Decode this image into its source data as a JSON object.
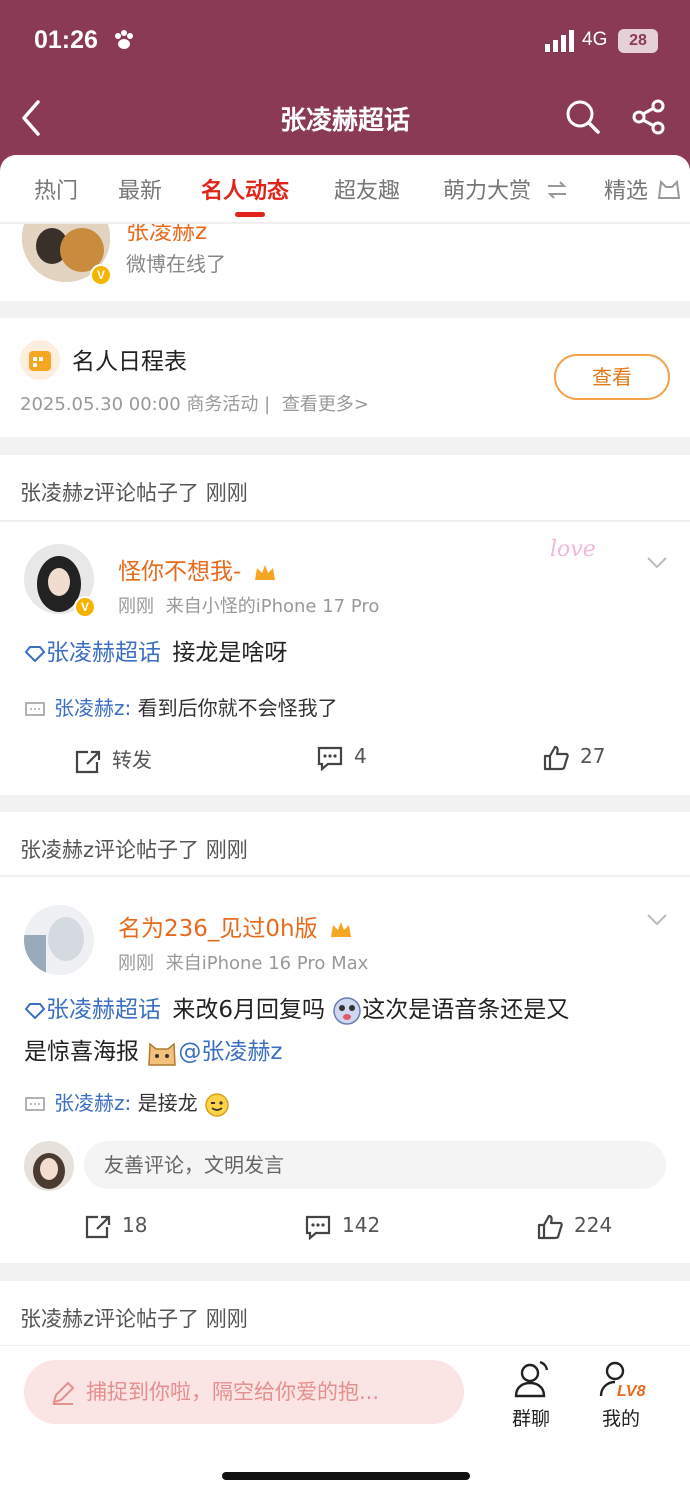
{
  "status_bar": {
    "time": "01:26",
    "network": "4G",
    "battery": "28"
  },
  "header": {
    "title": "张凌赫超话"
  },
  "tabs": [
    {
      "label": "热门"
    },
    {
      "label": "最新"
    },
    {
      "label": "名人动态",
      "active": true
    },
    {
      "label": "超友趣"
    },
    {
      "label": "萌力大赏"
    },
    {
      "label": "精选"
    }
  ],
  "top_user": {
    "name": "张凌赫z",
    "status": "微博在线了"
  },
  "schedule": {
    "title": "名人日程表",
    "info": "2025.05.30 00:00 商务活动 |",
    "more": "查看更多>",
    "button": "查看"
  },
  "posts": [
    {
      "section_title": "张凌赫z评论帖子了 刚刚",
      "author": "怪你不想我-",
      "time": "刚刚",
      "source": "来自小怪的iPhone 17 Pro",
      "topic": "张凌赫超话",
      "text": "接龙是啥呀",
      "mention": "",
      "comment_user": "张凌赫z:",
      "comment_text": "看到后你就不会怪我了",
      "repost": "转发",
      "comments": "4",
      "likes": "27"
    },
    {
      "section_title": "张凌赫z评论帖子了 刚刚",
      "author": "名为236_见过0h版",
      "time": "刚刚",
      "source": "来自iPhone 16 Pro Max",
      "topic": "张凌赫超话",
      "text": "来改6月回复吗",
      "text2": "这次是语音条还是又",
      "text3": "是惊喜海报",
      "mention": "@张凌赫z",
      "comment_user": "张凌赫z:",
      "comment_text": "是接龙",
      "reply_placeholder": "友善评论，文明发言",
      "repost": "18",
      "comments": "142",
      "likes": "224"
    }
  ],
  "next_section_title": "张凌赫z评论帖子了 刚刚",
  "bottom_bar": {
    "compose_placeholder": "捕捉到你啦，隔空给你爱的抱...",
    "group_chat": "群聊",
    "mine": "我的",
    "level": "LV8"
  },
  "colors": {
    "header": "#8b3a56",
    "accent": "#e0241a",
    "username": "#e86a1c",
    "link": "#3b6fc2"
  }
}
